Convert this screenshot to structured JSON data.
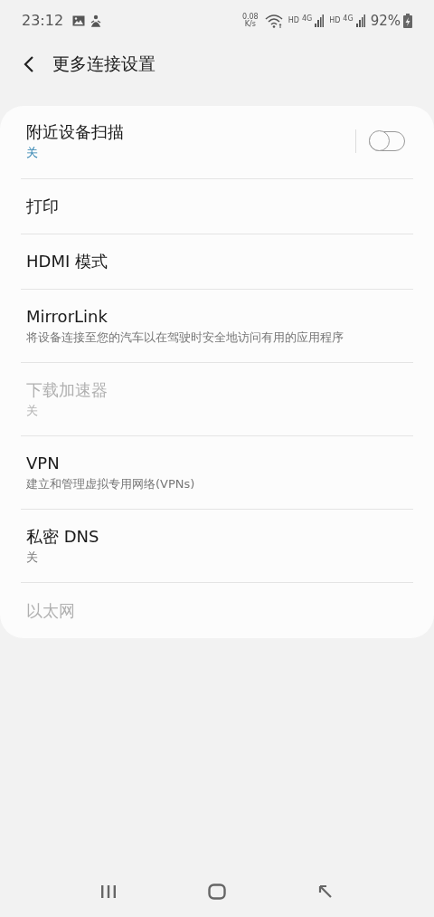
{
  "status_bar": {
    "time": "23:12",
    "net_speed": "0.08",
    "net_speed_unit": "K/s",
    "sim_1": {
      "hd": "HD",
      "network": "4G"
    },
    "sim_2": {
      "hd": "HD",
      "network": "4G"
    },
    "battery": "92%"
  },
  "header": {
    "title": "更多连接设置"
  },
  "items": [
    {
      "kind": "toggle",
      "title": "附近设备扫描",
      "summary": "关",
      "disabled": false,
      "on": false
    },
    {
      "kind": "plain",
      "title": "打印",
      "disabled": false
    },
    {
      "kind": "plain",
      "title": "HDMI 模式",
      "disabled": false
    },
    {
      "kind": "plain",
      "title": "MirrorLink",
      "summary": "将设备连接至您的汽车以在驾驶时安全地访问有用的应用程序",
      "disabled": false
    },
    {
      "kind": "plain",
      "title": "下载加速器",
      "summary": "关",
      "disabled": true
    },
    {
      "kind": "plain",
      "title": "VPN",
      "summary": "建立和管理虚拟专用网络(VPNs)",
      "disabled": false
    },
    {
      "kind": "plain",
      "title": "私密 DNS",
      "summary": "关",
      "disabled": false
    },
    {
      "kind": "plain",
      "title": "以太网",
      "disabled": true
    }
  ]
}
